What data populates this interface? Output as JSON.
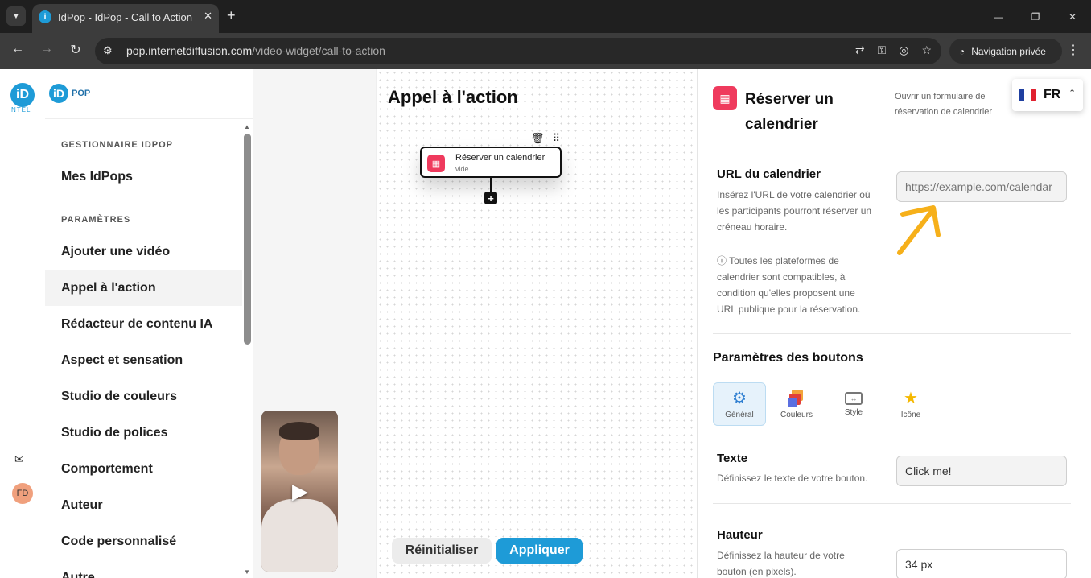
{
  "browser": {
    "tab_title": "IdPop - IdPop - Call to Action",
    "url_host": "pop.internetdiffusion.com",
    "url_path": "/video-widget/call-to-action",
    "private_label": "Navigation privée"
  },
  "brand": {
    "mark": "iD",
    "text": "POP"
  },
  "sidebar": {
    "section_manager": "GESTIONNAIRE IDPOP",
    "section_settings": "PARAMÈTRES",
    "manager_items": [
      {
        "label": "Mes IdPops"
      }
    ],
    "items": [
      {
        "label": "Ajouter une vidéo"
      },
      {
        "label": "Appel à l'action"
      },
      {
        "label": "Rédacteur de contenu IA"
      },
      {
        "label": "Aspect et sensation"
      },
      {
        "label": "Studio de couleurs"
      },
      {
        "label": "Studio de polices"
      },
      {
        "label": "Comportement"
      },
      {
        "label": "Auteur"
      },
      {
        "label": "Code personnalisé"
      },
      {
        "label": "Autre"
      }
    ],
    "active_item": "Appel à l'action"
  },
  "rail": {
    "mini_text": "NTEL",
    "avatar": "FD"
  },
  "editor": {
    "title": "Appel à l'action",
    "node": {
      "title": "Réserver un calendrier",
      "subtitle": "vide"
    },
    "reset_label": "Réinitialiser",
    "apply_label": "Appliquer"
  },
  "panel": {
    "title": "Réserver un calendrier",
    "description": "Ouvrir un formulaire de réservation de calendrier",
    "language": "FR",
    "url_field": {
      "label": "URL du calendrier",
      "help": "Insérez l'URL de votre calendrier où les participants pourront réserver un créneau horaire.",
      "note": "ⓘ Toutes les plateformes de calendrier sont compatibles, à condition qu'elles proposent une URL publique pour la réservation.",
      "placeholder": "https://example.com/calendar"
    },
    "buttons_section": "Paramètres des boutons",
    "button_tabs": [
      {
        "label": "Général",
        "icon": "gear-icon"
      },
      {
        "label": "Couleurs",
        "icon": "palette-icon"
      },
      {
        "label": "Style",
        "icon": "style-icon"
      },
      {
        "label": "Icône",
        "icon": "star-icon"
      }
    ],
    "text_field": {
      "label": "Texte",
      "help": "Définissez le texte de votre bouton.",
      "value": "Click me!"
    },
    "height_field": {
      "label": "Hauteur",
      "help": "Définissez la hauteur de votre bouton (en pixels).",
      "value": "34 px"
    }
  },
  "colors": {
    "accent": "#1e9bd7",
    "cta_icon": "#ef3a5d",
    "arrow": "#f6b01a"
  }
}
